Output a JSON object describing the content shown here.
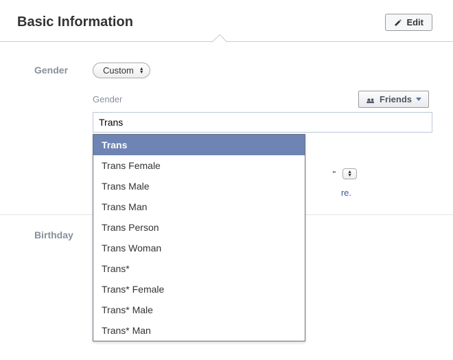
{
  "header": {
    "title": "Basic Information",
    "edit_label": "Edit"
  },
  "gender_row": {
    "label": "Gender",
    "select_value": "Custom"
  },
  "custom_gender": {
    "sub_label": "Gender",
    "audience_label": "Friends",
    "input_value": "Trans"
  },
  "dropdown": {
    "items": [
      {
        "label": "Trans",
        "selected": true
      },
      {
        "label": "Trans Female",
        "selected": false
      },
      {
        "label": "Trans Male",
        "selected": false
      },
      {
        "label": "Trans Man",
        "selected": false
      },
      {
        "label": "Trans Person",
        "selected": false
      },
      {
        "label": "Trans Woman",
        "selected": false
      },
      {
        "label": "Trans*",
        "selected": false
      },
      {
        "label": "Trans* Female",
        "selected": false
      },
      {
        "label": "Trans* Male",
        "selected": false
      },
      {
        "label": "Trans* Man",
        "selected": false
      }
    ]
  },
  "partial": {
    "quote": "\"",
    "link_tail": "re."
  },
  "birthday_row": {
    "label": "Birthday"
  }
}
